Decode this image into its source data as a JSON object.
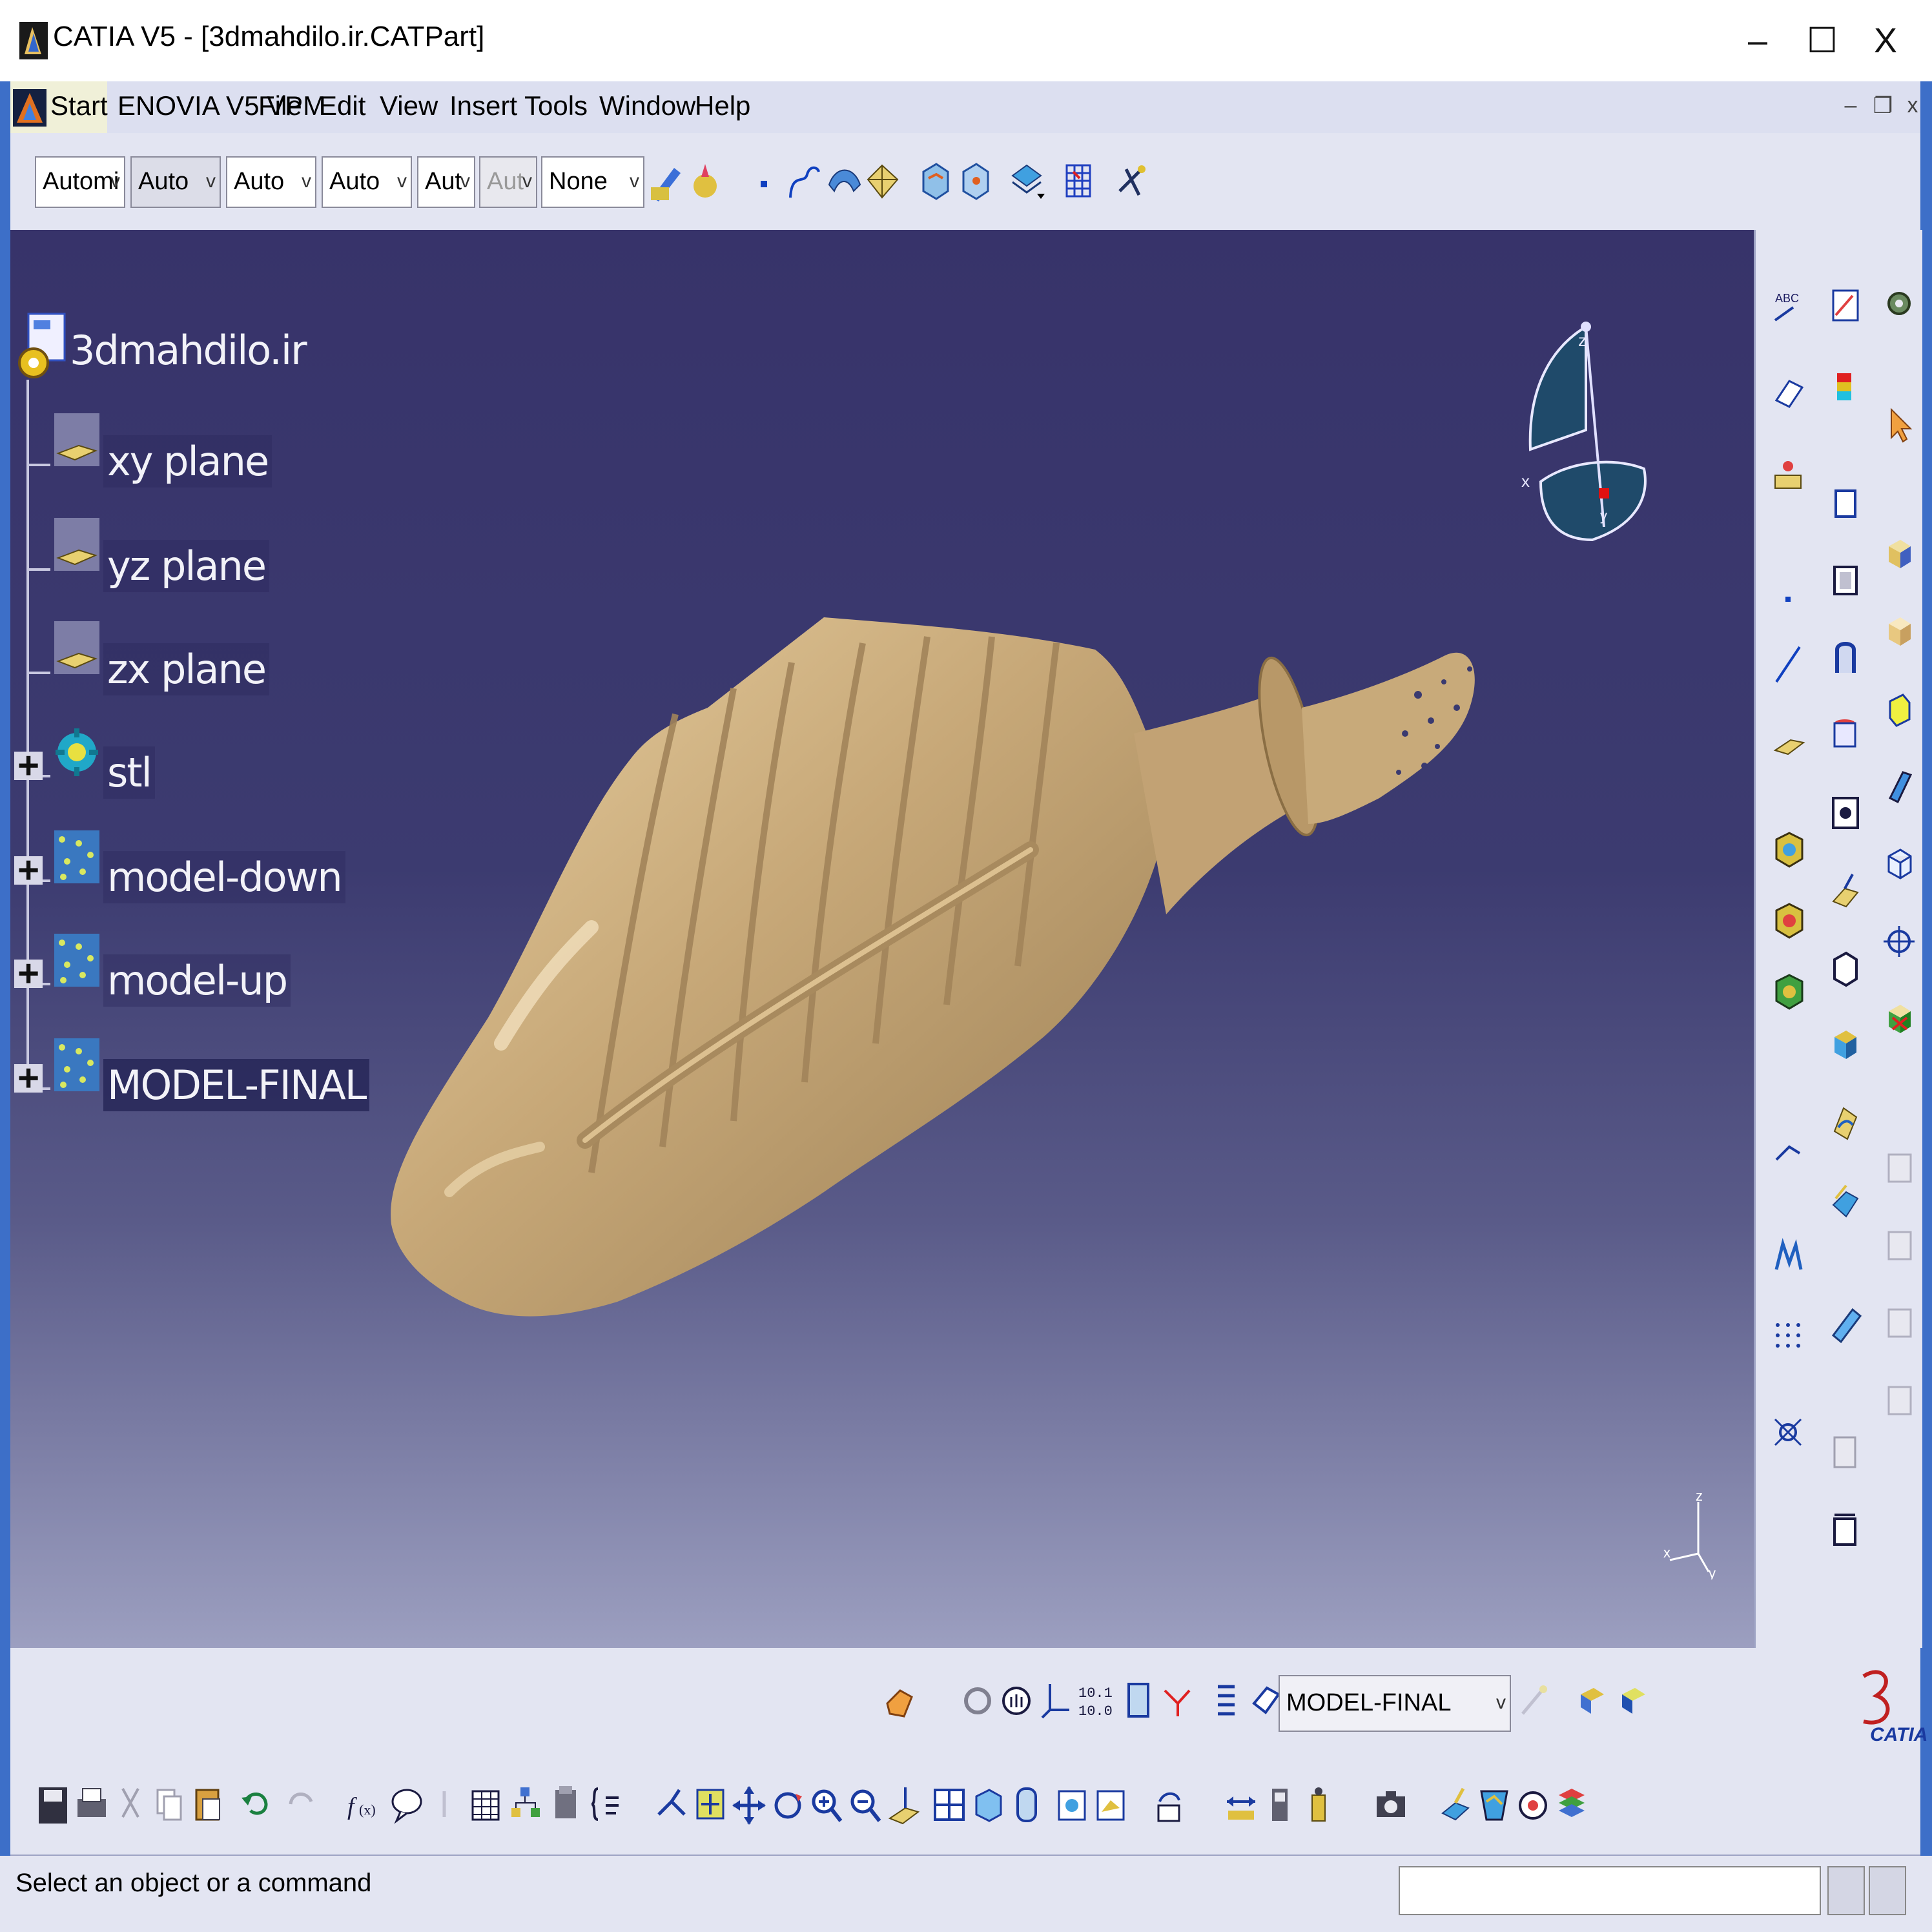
{
  "window": {
    "title": "CATIA V5 - [3dmahdilo.ir.CATPart]",
    "controls": {
      "minimize": "–",
      "maximize": "☐",
      "close": "X"
    }
  },
  "menubar": {
    "items": [
      "Start",
      "ENOVIA V5 VPM",
      "File",
      "Edit",
      "View",
      "Insert",
      "Tools",
      "Window",
      "Help"
    ],
    "mdi_controls": {
      "minimize": "–",
      "restore": "❐",
      "close": "x"
    }
  },
  "toolbar_top": {
    "combos": [
      "Automi",
      "Auto",
      "Auto",
      "Auto",
      "Aut",
      "Aut",
      "None"
    ]
  },
  "spec_tree": {
    "root": "3dmahdilo.ir",
    "items": [
      {
        "label": "xy plane",
        "icon": "plane-icon",
        "expandable": false
      },
      {
        "label": "yz plane",
        "icon": "plane-icon",
        "expandable": false
      },
      {
        "label": "zx plane",
        "icon": "plane-icon",
        "expandable": false
      },
      {
        "label": "stl",
        "icon": "geometrical-set-icon",
        "expandable": true
      },
      {
        "label": "model-down",
        "icon": "cloud-icon",
        "expandable": true
      },
      {
        "label": "model-up",
        "icon": "cloud-icon",
        "expandable": true
      },
      {
        "label": "MODEL-FINAL",
        "icon": "cloud-icon",
        "expandable": true
      }
    ]
  },
  "compass": {
    "x": "x",
    "y": "y",
    "z": "z"
  },
  "axis_triad": {
    "x": "x",
    "y": "y",
    "z": "z"
  },
  "toolbar_bottom": {
    "current_body_select": "MODEL-FINAL"
  },
  "brand": {
    "logo_text": "CATIA"
  },
  "statusbar": {
    "message": "Select an object or a command",
    "command_input": ""
  },
  "colors": {
    "model": "#c7a878",
    "viewport_top": "#37336a",
    "viewport_bottom": "#9c9fc0",
    "toolbar": "#e3e5f2",
    "menubar": "#dcdff0",
    "frame": "#3d6fc8"
  }
}
